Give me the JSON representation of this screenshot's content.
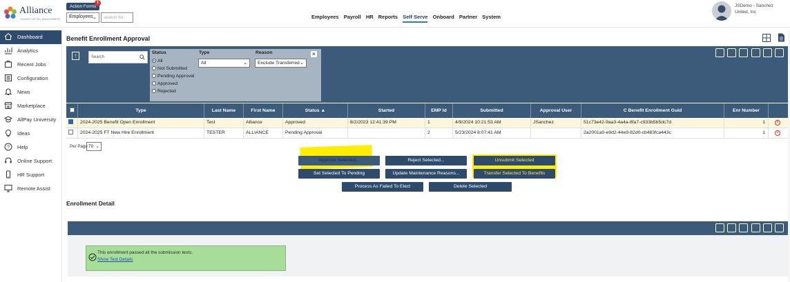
{
  "header": {
    "logo_text": "Alliance",
    "logo_sub": "HUMAN CAPITAL MANAGEMENT",
    "action_forms_label": "Action Forms",
    "action_forms_badge": "1",
    "employee_select": "Employees",
    "search_placeholder": "search for",
    "nav": [
      "Employees",
      "Payroll",
      "HR",
      "Reports",
      "Self Serve",
      "Onboard",
      "Partner",
      "System"
    ],
    "active_nav": "Self Serve",
    "user_name": "JSDemo - Sanchez United, Inc"
  },
  "sidebar": {
    "items": [
      {
        "label": "Dashboard",
        "icon": "home-icon"
      },
      {
        "label": "Analytics",
        "icon": "analytics-icon"
      },
      {
        "label": "Recent Jobs",
        "icon": "recent-jobs-icon"
      },
      {
        "label": "Configuration",
        "icon": "configuration-icon"
      },
      {
        "label": "News",
        "icon": "bell-icon"
      },
      {
        "label": "Marketplace",
        "icon": "store-icon"
      },
      {
        "label": "AllPay University",
        "icon": "graduation-icon"
      },
      {
        "label": "Ideas",
        "icon": "lightbulb-icon"
      },
      {
        "label": "Help",
        "icon": "help-icon"
      },
      {
        "label": "Online Support",
        "icon": "headset-icon"
      },
      {
        "label": "HR Support",
        "icon": "phone-icon"
      },
      {
        "label": "Remote Assist",
        "icon": "monitor-icon"
      }
    ],
    "collapse_glyph": "«"
  },
  "page": {
    "title": "Benefit Enrollment Approval",
    "colors": {
      "primary": "#2e4b6e",
      "panel": "#3c5a7a",
      "filter_box": "#a7b4c1",
      "highlight": "#ffee00",
      "success": "#a7dc9a",
      "danger": "#d9322b"
    }
  },
  "filters": {
    "search_placeholder": "Search",
    "status_label": "Status",
    "status_options": [
      "All",
      "Not Submitted",
      "Pending Approval",
      "Approved",
      "Rejected"
    ],
    "status_selected": "All",
    "type_label": "Type",
    "type_value": "All",
    "reason_label": "Reason",
    "reason_value": "Exclude Transferred",
    "close_glyph": "×"
  },
  "table": {
    "columns": [
      "",
      "Type",
      "Last Name",
      "First Name",
      "Status ▲",
      "Started",
      "EMP Id",
      "Submitted",
      "Approval User",
      "C Benefit Enrollment Guid",
      "Enr Number",
      ""
    ],
    "rows": [
      {
        "checked": true,
        "type": "2024-2025 Benefit Open Enrollment",
        "last": "Test",
        "first": "Alliance",
        "status": "Approved",
        "started": "8/2/2023 12:41:39 PM",
        "emp": "1",
        "submitted": "4/9/2024 10:21:53 AM",
        "user": "JSanchez",
        "guid": "51c73e42-9aa3-4a4a-8fa7-c933b5b5dc7d",
        "enr": "1"
      },
      {
        "checked": false,
        "type": "2024-2025 FT New Hire Enrollment",
        "last": "TESTER",
        "first": "ALLIANCE",
        "status": "Pending Approval",
        "started": "",
        "emp": "2",
        "submitted": "5/23/2024 8:07:41 AM",
        "user": "",
        "guid": "2a2001a0-e9d2-44e9-82d0-cb483fca443c",
        "enr": "1"
      }
    ],
    "per_page_label": "Per Page",
    "per_page_value": "70"
  },
  "actions": {
    "approve": "Approve Selected...",
    "reject": "Reject Selected...",
    "unsubmit": "Unsubmit Selected",
    "set_pending": "Set Selected To Pending",
    "update_reasons": "Update Maintenance Reasons...",
    "transfer": "Transfer Selected To Benefits",
    "process_failed": "Process As Failed To Elect",
    "delete": "Delete Selected"
  },
  "detail": {
    "title": "Enrollment Detail",
    "message": "This enrollment passed all the submission tests.",
    "link": "Show Test Details"
  }
}
